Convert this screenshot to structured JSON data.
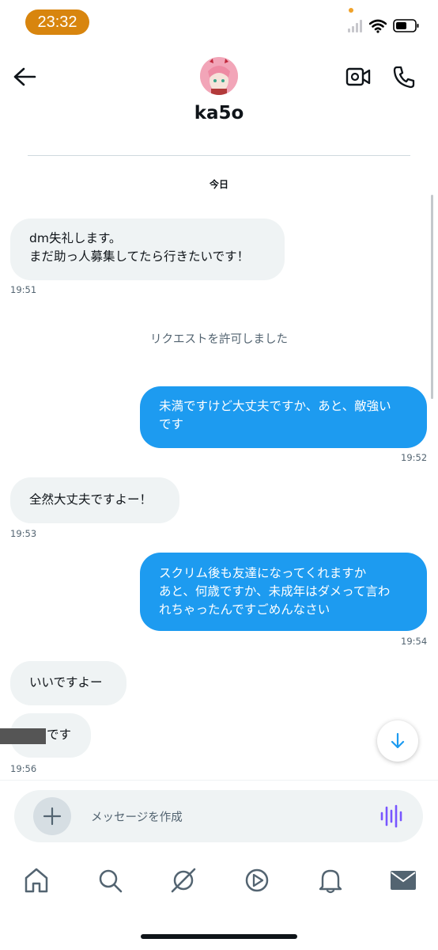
{
  "status_bar": {
    "time": "23:32"
  },
  "header": {
    "username": "ka5o"
  },
  "conversation": {
    "date_label": "今日",
    "system_message": "リクエストを許可しました",
    "messages": [
      {
        "dir": "in",
        "text": "dm失礼します。\nまだ助っ人募集してたら行きたいです！",
        "time": "19:51"
      },
      {
        "dir": "out",
        "text": "未満ですけど大丈夫ですか、あと、敵強い\nです",
        "time": "19:52"
      },
      {
        "dir": "in",
        "text": "全然大丈夫ですよー！",
        "time": "19:53"
      },
      {
        "dir": "out",
        "text": "スクリム後も友達になってくれますか\nあと、何歳ですか、未成年はダメって言わ\nれちゃったんですごめんなさい",
        "time": "19:54"
      },
      {
        "dir": "in",
        "text": "いいですよー",
        "time": ""
      },
      {
        "dir": "in",
        "text": "です",
        "time": "19:56"
      }
    ]
  },
  "composer": {
    "placeholder": "メッセージを作成"
  },
  "colors": {
    "accent": "#1d9bf0",
    "incoming_bubble": "#eff3f4",
    "time_pill": "#d8850e",
    "voice_icon": "#7856ff"
  },
  "icons": [
    "back-arrow-icon",
    "video-call-icon",
    "phone-icon",
    "scroll-down-icon",
    "plus-icon",
    "voice-wave-icon",
    "home-icon",
    "search-icon",
    "grok-icon",
    "video-tab-icon",
    "bell-icon",
    "mail-icon"
  ]
}
